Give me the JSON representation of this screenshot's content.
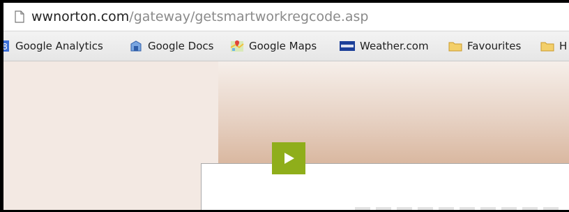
{
  "address_bar": {
    "domain": "wwnorton.com",
    "path": "/gateway/getsmartworkregcode.asp"
  },
  "bookmarks": [
    {
      "label": "Google Analytics",
      "icon": "google-analytics-icon"
    },
    {
      "label": "Google Docs",
      "icon": "google-docs-icon"
    },
    {
      "label": "Google Maps",
      "icon": "google-maps-icon"
    },
    {
      "label": "Weather.com",
      "icon": "weather-com-icon"
    },
    {
      "label": "Favourites",
      "icon": "folder-icon"
    },
    {
      "label": "H",
      "icon": "folder-icon"
    }
  ],
  "video_overlay": {
    "icon": "play-icon",
    "color": "#8fae1b"
  }
}
